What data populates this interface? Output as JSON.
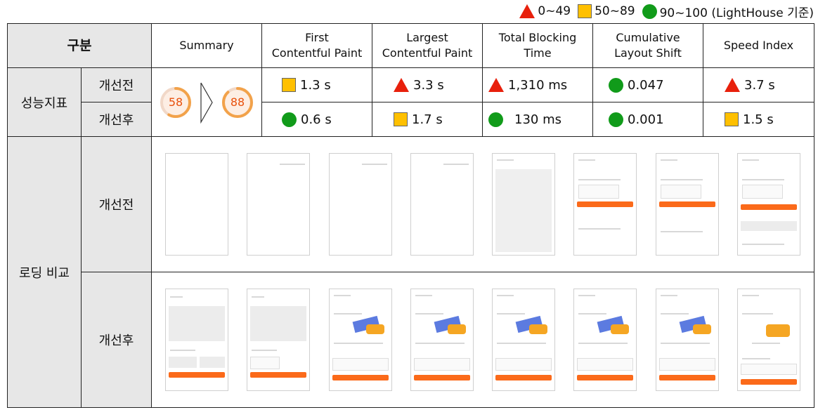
{
  "legend": [
    {
      "icon": "triangle",
      "label": "0~49",
      "color": "#e8200c"
    },
    {
      "icon": "square",
      "label": "50~89",
      "color": "#ffc000"
    },
    {
      "icon": "circle",
      "label": "90~100 (LightHouse 기준)",
      "color": "#119b1a"
    }
  ],
  "header": {
    "category": "구분",
    "summary": "Summary",
    "fcp": [
      "First",
      "Contentful Paint"
    ],
    "lcp": [
      "Largest",
      "Contentful Paint"
    ],
    "tbt": [
      "Total Blocking",
      "Time"
    ],
    "cls": [
      "Cumulative",
      "Layout Shift"
    ],
    "si": "Speed Index"
  },
  "metrics": {
    "group_label": "성능지표",
    "before_label": "개선전",
    "after_label": "개선후",
    "score_before": 58,
    "score_after": 88,
    "before": {
      "fcp": {
        "value": "1.3 s",
        "rating": "square"
      },
      "lcp": {
        "value": "3.3 s",
        "rating": "triangle"
      },
      "tbt": {
        "value": "1,310 ms",
        "rating": "triangle"
      },
      "cls": {
        "value": "0.047",
        "rating": "circle"
      },
      "si": {
        "value": "3.7 s",
        "rating": "triangle"
      }
    },
    "after": {
      "fcp": {
        "value": "0.6 s",
        "rating": "circle"
      },
      "lcp": {
        "value": "1.7 s",
        "rating": "square"
      },
      "tbt": {
        "value": "130 ms",
        "rating": "circle"
      },
      "cls": {
        "value": "0.001",
        "rating": "circle"
      },
      "si": {
        "value": "1.5 s",
        "rating": "square"
      }
    }
  },
  "loading": {
    "group_label": "로딩 비교",
    "before_label": "개선전",
    "after_label": "개선후"
  },
  "colors": {
    "header_bg": "#e7e7e7",
    "gauge_orange": "#e8500c",
    "accent_orange": "#fb6a1a"
  }
}
